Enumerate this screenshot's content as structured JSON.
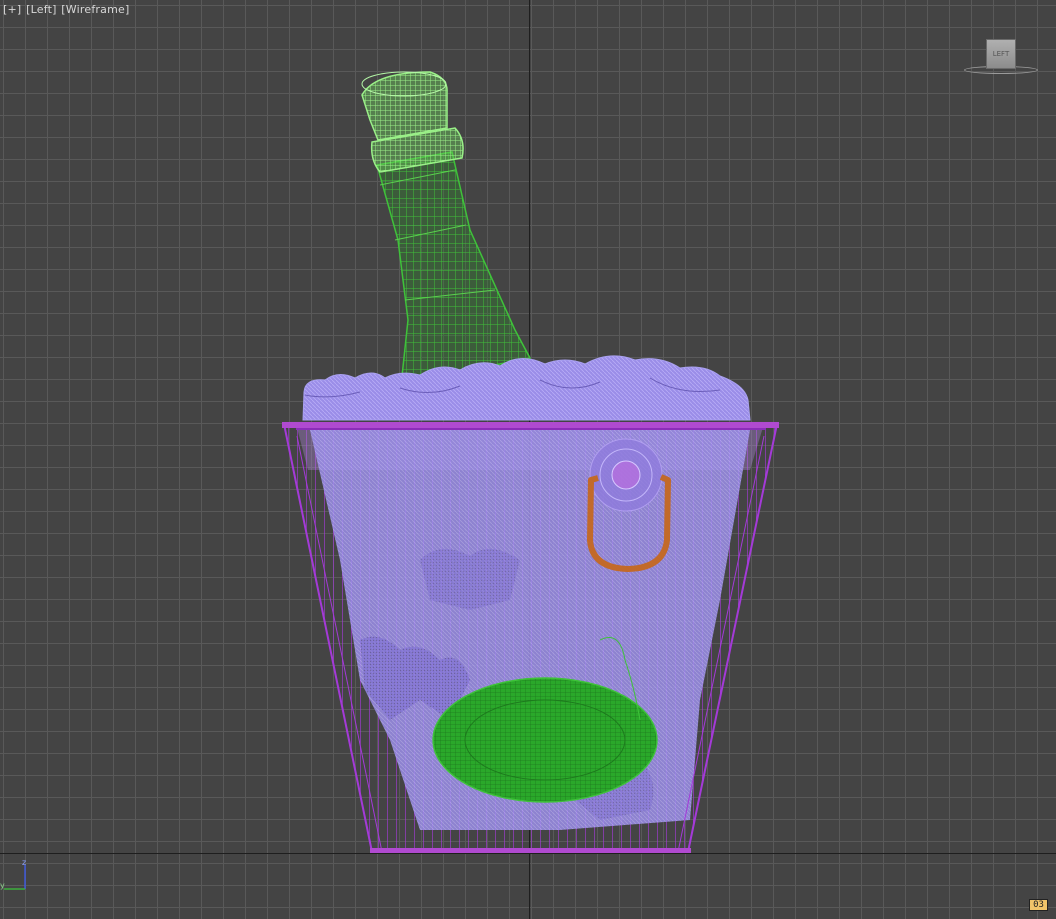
{
  "viewport": {
    "menu_plus": "[+]",
    "view_name": "[Left]",
    "shading_mode": "[Wireframe]",
    "viewcube_label": "LEFT",
    "frame_badge": "03",
    "axis_z_label": "z",
    "axis_y_label": "y"
  },
  "colors": {
    "background": "#444444",
    "grid_line": "#595959",
    "world_axis": "#1e1e1e",
    "bottle_wire": "#3fc23a",
    "bottle_neck_wire": "#8ef07c",
    "ice_wire": "#9a8de8",
    "bucket_wire": "#a43ad8",
    "handle": "#c26a2a",
    "bucket_ring": "#b04ad0"
  },
  "scene_objects": [
    "bottle",
    "ice",
    "bucket",
    "handle",
    "handle_mount"
  ]
}
